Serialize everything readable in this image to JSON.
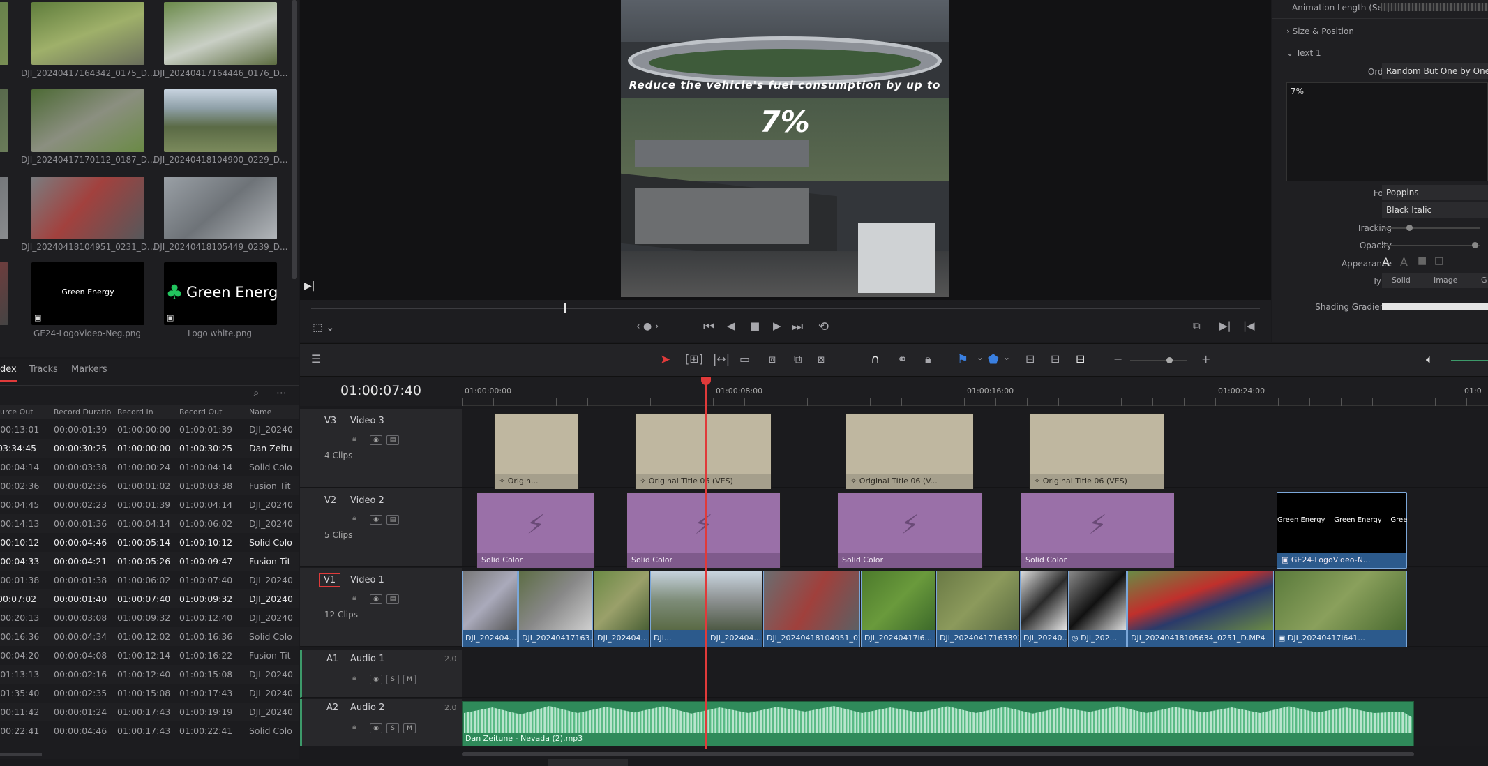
{
  "media_pool": {
    "clips": [
      {
        "name": "DJI_20240417164342_0175_D..."
      },
      {
        "name": "DJI_20240417164446_0176_D..."
      },
      {
        "name": "DJI_20240417170112_0187_D..."
      },
      {
        "name": "DJI_20240418104900_0229_D..."
      },
      {
        "name": "DJI_20240418104951_0231_D..."
      },
      {
        "name": "DJI_20240418105449_0239_D..."
      },
      {
        "name": "GE24-LogoVideo-Neg.png",
        "logo_text": "Green Energy"
      },
      {
        "name": "Logo white.png",
        "logo_text": "Green Energy"
      }
    ]
  },
  "viewer": {
    "overlay_line1": "Reduce the vehicle's fuel consumption by up to",
    "overlay_line2": "7%",
    "playhead_fraction": 0.267
  },
  "inspector": {
    "animation_length_label": "Animation Length (Sec)",
    "size_position_label": "Size & Position",
    "text1_label": "Text 1",
    "order_label": "Order",
    "order_value": "Random But One by One",
    "text_content": "7%",
    "font_label": "Font",
    "font_value": "Poppins",
    "font_style_value": "Black Italic",
    "tracking_label": "Tracking",
    "opacity_label": "Opacity",
    "appearance_label": "Appearance",
    "type_label": "Type",
    "type_options": [
      "Solid",
      "Image",
      "G"
    ],
    "shading_gradient_label": "Shading Gradient"
  },
  "edit_index": {
    "tabs": [
      "dex",
      "Tracks",
      "Markers"
    ],
    "columns": [
      "urce Out",
      "Record Duratio",
      "Record In",
      "Record Out",
      "Name"
    ],
    "rows": [
      {
        "src_out": ":00:13:01",
        "dur": "00:00:01:39",
        "rec_in": "01:00:00:00",
        "rec_out": "01:00:01:39",
        "name": "DJI_20240",
        "bright": false
      },
      {
        "src_out": "03:34:45",
        "dur": "00:00:30:25",
        "rec_in": "01:00:00:00",
        "rec_out": "01:00:30:25",
        "name": "Dan Zeitu",
        "bright": true
      },
      {
        "src_out": ":00:04:14",
        "dur": "00:00:03:38",
        "rec_in": "01:00:00:24",
        "rec_out": "01:00:04:14",
        "name": "Solid Colo",
        "bright": false
      },
      {
        "src_out": ":00:02:36",
        "dur": "00:00:02:36",
        "rec_in": "01:00:01:02",
        "rec_out": "01:00:03:38",
        "name": "Fusion Tit",
        "bright": false
      },
      {
        "src_out": ":00:04:45",
        "dur": "00:00:02:23",
        "rec_in": "01:00:01:39",
        "rec_out": "01:00:04:14",
        "name": "DJI_20240",
        "bright": false
      },
      {
        "src_out": ":00:14:13",
        "dur": "00:00:01:36",
        "rec_in": "01:00:04:14",
        "rec_out": "01:00:06:02",
        "name": "DJI_20240",
        "bright": false
      },
      {
        "src_out": ":00:10:12",
        "dur": "00:00:04:46",
        "rec_in": "01:00:05:14",
        "rec_out": "01:00:10:12",
        "name": "Solid Colo",
        "bright": true
      },
      {
        "src_out": ":00:04:33",
        "dur": "00:00:04:21",
        "rec_in": "01:00:05:26",
        "rec_out": "01:00:09:47",
        "name": "Fusion Tit",
        "bright": true
      },
      {
        "src_out": ":00:01:38",
        "dur": "00:00:01:38",
        "rec_in": "01:00:06:02",
        "rec_out": "01:00:07:40",
        "name": "DJI_20240",
        "bright": false
      },
      {
        "src_out": "00:07:02",
        "dur": "00:00:01:40",
        "rec_in": "01:00:07:40",
        "rec_out": "01:00:09:32",
        "name": "DJI_20240",
        "bright": true
      },
      {
        "src_out": ":00:20:13",
        "dur": "00:00:03:08",
        "rec_in": "01:00:09:32",
        "rec_out": "01:00:12:40",
        "name": "DJI_20240",
        "bright": false
      },
      {
        "src_out": ":00:16:36",
        "dur": "00:00:04:34",
        "rec_in": "01:00:12:02",
        "rec_out": "01:00:16:36",
        "name": "Solid Colo",
        "bright": false
      },
      {
        "src_out": ":00:04:20",
        "dur": "00:00:04:08",
        "rec_in": "01:00:12:14",
        "rec_out": "01:00:16:22",
        "name": "Fusion Tit",
        "bright": false
      },
      {
        "src_out": ":01:13:13",
        "dur": "00:00:02:16",
        "rec_in": "01:00:12:40",
        "rec_out": "01:00:15:08",
        "name": "DJI_20240",
        "bright": false
      },
      {
        "src_out": ":01:35:40",
        "dur": "00:00:02:35",
        "rec_in": "01:00:15:08",
        "rec_out": "01:00:17:43",
        "name": "DJI_20240",
        "bright": false
      },
      {
        "src_out": ":00:11:42",
        "dur": "00:00:01:24",
        "rec_in": "01:00:17:43",
        "rec_out": "01:00:19:19",
        "name": "DJI_20240",
        "bright": false
      },
      {
        "src_out": ":00:22:41",
        "dur": "00:00:04:46",
        "rec_in": "01:00:17:43",
        "rec_out": "01:00:22:41",
        "name": "Solid Colo",
        "bright": false
      }
    ]
  },
  "timeline": {
    "timecode": "01:00:07:40",
    "ruler_marks": [
      "01:00:00:00",
      "01:00:08:00",
      "01:00:16:00",
      "01:00:24:00",
      "01:0"
    ],
    "tracks": [
      {
        "id": "V3",
        "name": "Video 3",
        "count": "4 Clips"
      },
      {
        "id": "V2",
        "name": "Video 2",
        "count": "5 Clips"
      },
      {
        "id": "V1",
        "name": "Video 1",
        "count": "12 Clips"
      },
      {
        "id": "A1",
        "name": "Audio 1",
        "level": "2.0"
      },
      {
        "id": "A2",
        "name": "Audio 2",
        "level": "2.0"
      }
    ],
    "v3_clips": [
      "Origin...",
      "Original Title 06 (VES)",
      "Original Title 06 (V...",
      "Original Title 06 (VES)"
    ],
    "v2_clips": [
      "Solid Color",
      "Solid Color",
      "Solid Color",
      "Solid Color",
      "GE24-LogoVideo-N..."
    ],
    "v2_logo_text": "Green Energy",
    "v1_clips": [
      "DJI_202404...",
      "DJI_20240417163...",
      "DJI_202404...",
      "DJI...",
      "DJI_202404...",
      "DJI_20240418104951_02...",
      "DJI_20240417l6...",
      "DJI_20240417163393...",
      "DJI_20240...",
      "DJI_202...",
      "DJI_20240418105634_0251_D.MP4",
      "DJI_20240417l641..."
    ],
    "a2_clip": "Dan Zeitune - Nevada (2).mp3",
    "s_label": "S",
    "m_label": "M"
  },
  "colors": {
    "accent": "#e03a3a",
    "v3": "#bfb7a0",
    "v2": "#9a70a8",
    "v1": "#2c5a8c",
    "audio": "#3d9a6a"
  }
}
